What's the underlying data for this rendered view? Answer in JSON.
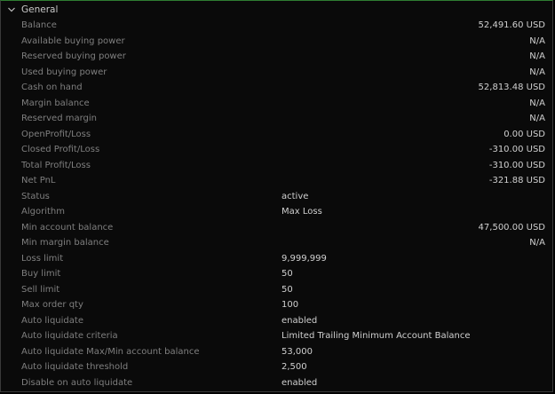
{
  "section": {
    "title": "General",
    "chevron_icon": "chevron-down-icon"
  },
  "rows": [
    {
      "label": "Balance",
      "value": "52,491.60 USD",
      "align": "right"
    },
    {
      "label": "Available buying power",
      "value": "N/A",
      "align": "right"
    },
    {
      "label": "Reserved buying power",
      "value": "N/A",
      "align": "right"
    },
    {
      "label": "Used buying power",
      "value": "N/A",
      "align": "right"
    },
    {
      "label": "Cash on hand",
      "value": "52,813.48 USD",
      "align": "right"
    },
    {
      "label": "Margin balance",
      "value": "N/A",
      "align": "right"
    },
    {
      "label": "Reserved margin",
      "value": "N/A",
      "align": "right"
    },
    {
      "label": "OpenProfit/Loss",
      "value": "0.00 USD",
      "align": "right"
    },
    {
      "label": "Closed Profit/Loss",
      "value": "-310.00 USD",
      "align": "right"
    },
    {
      "label": "Total Profit/Loss",
      "value": "-310.00 USD",
      "align": "right"
    },
    {
      "label": "Net PnL",
      "value": "-321.88 USD",
      "align": "right"
    },
    {
      "label": "Status",
      "value": "active",
      "align": "mid"
    },
    {
      "label": "Algorithm",
      "value": "Max Loss",
      "align": "mid"
    },
    {
      "label": "Min account balance",
      "value": "47,500.00 USD",
      "align": "right"
    },
    {
      "label": "Min margin balance",
      "value": "N/A",
      "align": "right"
    },
    {
      "label": "Loss limit",
      "value": "9,999,999",
      "align": "mid"
    },
    {
      "label": "Buy limit",
      "value": "50",
      "align": "mid"
    },
    {
      "label": "Sell limit",
      "value": "50",
      "align": "mid"
    },
    {
      "label": "Max order qty",
      "value": "100",
      "align": "mid"
    },
    {
      "label": "Auto liquidate",
      "value": "enabled",
      "align": "mid"
    },
    {
      "label": "Auto liquidate criteria",
      "value": "Limited Trailing Minimum Account Balance",
      "align": "mid"
    },
    {
      "label": "Auto liquidate Max/Min account balance",
      "value": "53,000",
      "align": "mid"
    },
    {
      "label": "Auto liquidate threshold",
      "value": "2,500",
      "align": "mid"
    },
    {
      "label": "Disable on auto liquidate",
      "value": "enabled",
      "align": "mid"
    }
  ],
  "colors": {
    "background": "#0a0a0a",
    "label": "#7f7f7f",
    "value": "#d0d0d0",
    "accent_border": "#2e7d32"
  }
}
